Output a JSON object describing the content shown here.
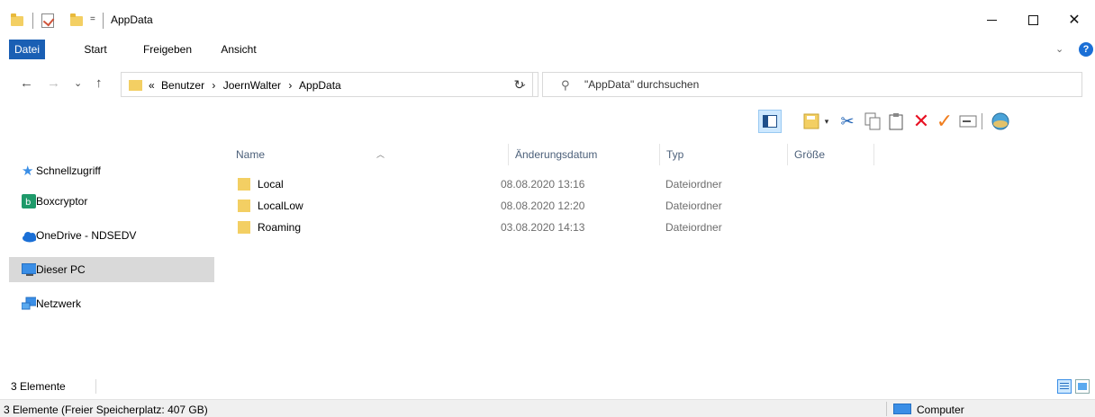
{
  "window": {
    "title": "AppData",
    "qa_dropdown": "=",
    "minimize": "—",
    "maximize": "☐",
    "close": "✕"
  },
  "ribbon": {
    "tabs": [
      {
        "label": "Datei",
        "active": true
      },
      {
        "label": "Start"
      },
      {
        "label": "Freigeben"
      },
      {
        "label": "Ansicht"
      }
    ],
    "help": "?"
  },
  "navigation": {
    "back": "←",
    "forward": "→",
    "recent": "⌄",
    "up": "↑",
    "path_overflow": "«",
    "breadcrumb": [
      "Benutzer",
      "JoernWalter",
      "AppData"
    ],
    "breadcrumb_separator": "›",
    "refresh": "↻",
    "search_placeholder": "\"AppData\" durchsuchen"
  },
  "sidebar": {
    "items": [
      {
        "label": "Schnellzugriff",
        "icon": "star-icon"
      },
      {
        "label": "Boxcryptor",
        "icon": "boxcryptor-icon"
      },
      {
        "label": "OneDrive - NDSEDV",
        "icon": "cloud-icon"
      },
      {
        "label": "Dieser PC",
        "icon": "computer-icon",
        "selected": true
      },
      {
        "label": "Netzwerk",
        "icon": "network-icon"
      }
    ]
  },
  "columns": {
    "name": "Name",
    "date": "Änderungsdatum",
    "type": "Typ",
    "size": "Größe"
  },
  "files": [
    {
      "name": "Local",
      "date": "08.08.2020 13:16",
      "type": "Dateiordner"
    },
    {
      "name": "LocalLow",
      "date": "08.08.2020 12:20",
      "type": "Dateiordner"
    },
    {
      "name": "Roaming",
      "date": "03.08.2020 14:13",
      "type": "Dateiordner"
    }
  ],
  "status": {
    "item_count": "3 Elemente",
    "free_space": "3 Elemente (Freier Speicherplatz: 407 GB)",
    "location": "Computer"
  },
  "colors": {
    "accent": "#1a5fb4",
    "folder": "#f3cf63",
    "selection": "#d9d9d9",
    "delete": "#e81123",
    "check": "#f07d1e"
  }
}
